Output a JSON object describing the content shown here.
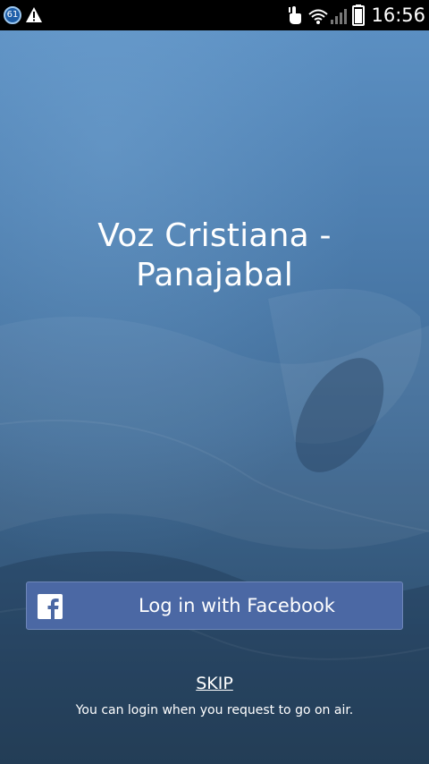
{
  "status_bar": {
    "notification_badge": "61",
    "time": "16:56",
    "icons": [
      "notification-count-icon",
      "warning-icon",
      "touch-icon",
      "wifi-icon",
      "signal-icon",
      "battery-icon"
    ]
  },
  "app": {
    "title": "Voz Cristiana - Panajabal",
    "facebook_button_label": "Log in with Facebook",
    "skip_label": "SKIP",
    "hint": "You can login when you request to go on air."
  },
  "colors": {
    "facebook_blue": "#4b68a4",
    "background_top": "#5b8fc2",
    "background_bottom": "#2a465f"
  }
}
